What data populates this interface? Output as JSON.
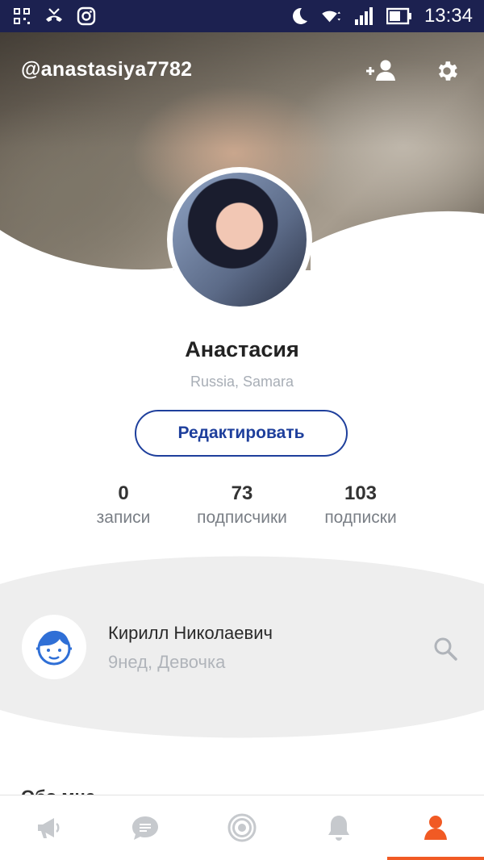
{
  "status_bar": {
    "time": "13:34"
  },
  "header": {
    "username": "@anastasiya7782"
  },
  "profile": {
    "name": "Анастасия",
    "location": "Russia, Samara",
    "edit_label": "Редактировать"
  },
  "stats": [
    {
      "value": "0",
      "label": "записи"
    },
    {
      "value": "73",
      "label": "подписчики"
    },
    {
      "value": "103",
      "label": "подписки"
    }
  ],
  "child": {
    "name": "Кирилл Николаевич",
    "details": "9нед, Девочка"
  },
  "section_peek": "Обо мне",
  "colors": {
    "accent": "#f15a24",
    "primary": "#1e3f9c",
    "statusbar": "#1c2150"
  },
  "bottom_nav": [
    {
      "icon": "megaphone-icon"
    },
    {
      "icon": "chat-icon"
    },
    {
      "icon": "target-icon"
    },
    {
      "icon": "bell-icon"
    },
    {
      "icon": "profile-icon",
      "active": true
    }
  ]
}
